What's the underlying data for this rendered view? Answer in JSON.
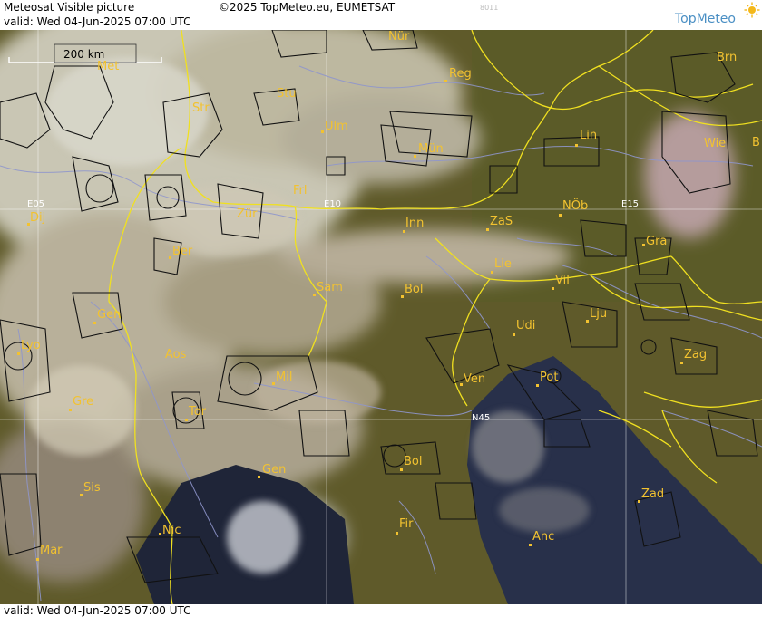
{
  "header": {
    "title": "Meteosat Visible picture",
    "valid_label": "valid:",
    "valid_time": "Wed  04-Jun-2025  07:00 UTC",
    "copyright": "©2025 TopMeteo.eu, EUMETSAT",
    "image_code": "8011",
    "brand": "TopMeteo"
  },
  "footer": {
    "valid_label": "valid:",
    "valid_time": "Wed  04-Jun-2025  07:00 UTC"
  },
  "scale": {
    "label": "200 km"
  },
  "grid_labels": [
    "E05",
    "E10",
    "E15",
    "N45"
  ],
  "cities": [
    "Met",
    "Nür",
    "Reg",
    "Brn",
    "Str",
    "Stu",
    "Ulm",
    "Mün",
    "Lin",
    "Wie",
    "Dij",
    "Frl",
    "Zür",
    "Inn",
    "ZaS",
    "NÖb",
    "Ber",
    "Gra",
    "Lie",
    "Sam",
    "Bol",
    "Vil",
    "Gen",
    "Lju",
    "Udi",
    "Lyo",
    "Aos",
    "Mil",
    "Ven",
    "Pot",
    "Zag",
    "Gre",
    "Tor",
    "Bol",
    "Gen",
    "Sis",
    "Zad",
    "Nic",
    "Fir",
    "Mar",
    "Anc",
    "B"
  ],
  "colors": {
    "city_label": "#f2c230",
    "border": "#f0e020",
    "brand": "#4a8fc4"
  }
}
